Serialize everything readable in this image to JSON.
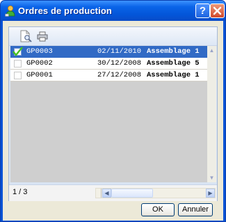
{
  "window": {
    "title": "Ordres de production"
  },
  "titlebar_buttons": {
    "help": "?",
    "close": "X"
  },
  "toolbar": {
    "icons": [
      "search-document-icon",
      "print-icon"
    ]
  },
  "grid": {
    "rows": [
      {
        "checked": true,
        "selected": true,
        "code": "GP0003",
        "date": "02/11/2010",
        "description": "Assemblage 1"
      },
      {
        "checked": false,
        "selected": false,
        "code": "GP0002",
        "date": "30/12/2008",
        "description": "Assemblage 5"
      },
      {
        "checked": false,
        "selected": false,
        "code": "GP0001",
        "date": "27/12/2008",
        "description": "Assemblage 1"
      }
    ]
  },
  "pager": {
    "label": "1 / 3"
  },
  "buttons": {
    "ok": "OK",
    "cancel": "Annuler"
  },
  "colors": {
    "titlebar": "#0a53d6",
    "selection": "#316ac5",
    "client": "#ece9d8"
  }
}
